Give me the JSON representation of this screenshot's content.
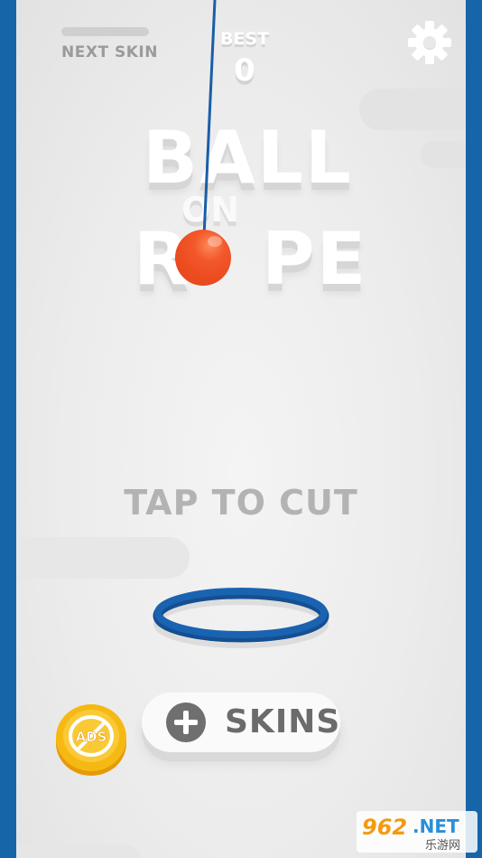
{
  "hud": {
    "next_skin_label": "NEXT SKIN",
    "next_skin_progress": 0,
    "best_label": "BEST",
    "best_value": "0",
    "settings_icon": "gear-icon"
  },
  "title": {
    "line1": "BALL",
    "line2": "ON",
    "line3_left": "R",
    "line3_right": "PE"
  },
  "prompt": "TAP TO CUT",
  "buttons": {
    "no_ads_label": "ADS",
    "skins_label": "SKINS",
    "skins_icon": "plus-icon"
  },
  "watermark": {
    "brand": "962",
    "suffix": ".NET",
    "cn_text": "乐游网"
  },
  "colors": {
    "border_blue": "#1565a8",
    "ball_orange": "#ea4a1d",
    "hoop_blue": "#1a5ea8",
    "coin_gold": "#f6b913"
  }
}
